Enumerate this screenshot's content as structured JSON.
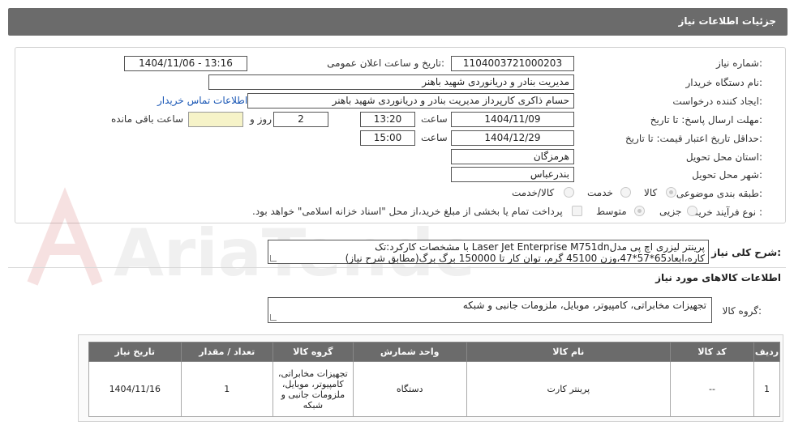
{
  "header": {
    "title": "جزئیات اطلاعات نیاز"
  },
  "form": {
    "need_number_label": "شماره نیاز:",
    "need_number": "1104003721000203",
    "announce_label": "تاریخ و ساعت اعلان عمومی:",
    "announce_value": "1404/11/06 - 13:16",
    "buyer_org_label": "نام دستگاه خریدار:",
    "buyer_org": "مدیریت بنادر و دریانوردی شهید باهنر",
    "requester_label": "ایجاد کننده درخواست:",
    "requester": "حسام  ذاکری کارپرداز مدیریت بنادر و دریانوردی شهید باهنر",
    "contact_link": "اطلاعات تماس خریدار",
    "deadline_label": "مهلت ارسال پاسخ: تا تاریخ:",
    "deadline_date": "1404/11/09",
    "time_label": "ساعت",
    "deadline_time": "13:20",
    "days_value": "2",
    "days_label": "روز و",
    "remaining_value": "",
    "remaining_label": "ساعت باقی مانده",
    "validity_label": "حداقل تاریخ اعتبار قیمت: تا تاریخ:",
    "validity_date": "1404/12/29",
    "validity_time": "15:00",
    "province_label": "استان محل تحویل:",
    "province": "هرمزگان",
    "city_label": "شهر محل تحویل:",
    "city": "بندرعباس",
    "category_label": "طبقه بندی موضوعی:",
    "category_options": [
      "کالا",
      "خدمت",
      "کالا/خدمت"
    ],
    "process_label": "نوع فرآیند خرید :",
    "process_options": [
      "جزیی",
      "متوسط"
    ],
    "payment_note": "پرداخت تمام یا بخشی از مبلغ خرید،از محل \"اسناد خزانه اسلامی\" خواهد بود."
  },
  "description": {
    "label": "شرح کلی نیاز:",
    "text": "پرینتر لیزری اچ پی مدلLaser Jet Enterprise M751dn با مشخصات کارکرد:تک کاره،ابعاد65*57*47،وزن 45100 گرم، توان کار تا 150000 برگ برگ(مطابق شرح نیاز)"
  },
  "goods": {
    "section_title": "اطلاعات کالاهای مورد نیاز",
    "group_label": "گروه کالا:",
    "group_value": "تجهیزات مخابراتی، کامپیوتر، موبایل، ملزومات جانبی و شبکه",
    "columns": [
      "ردیف",
      "کد کالا",
      "نام کالا",
      "واحد شمارش",
      "گروه کالا",
      "تعداد / مقدار",
      "تاریخ نیاز"
    ],
    "rows": [
      {
        "index": "1",
        "code": "--",
        "name": "پرینتر کارت",
        "unit": "دستگاه",
        "group": "تجهیزات مخابراتی، کامپیوتر، موبایل، ملزومات جانبی و شبکه",
        "qty": "1",
        "date": "1404/11/16"
      }
    ]
  },
  "watermark": {
    "text": "AriaTender.neT"
  }
}
